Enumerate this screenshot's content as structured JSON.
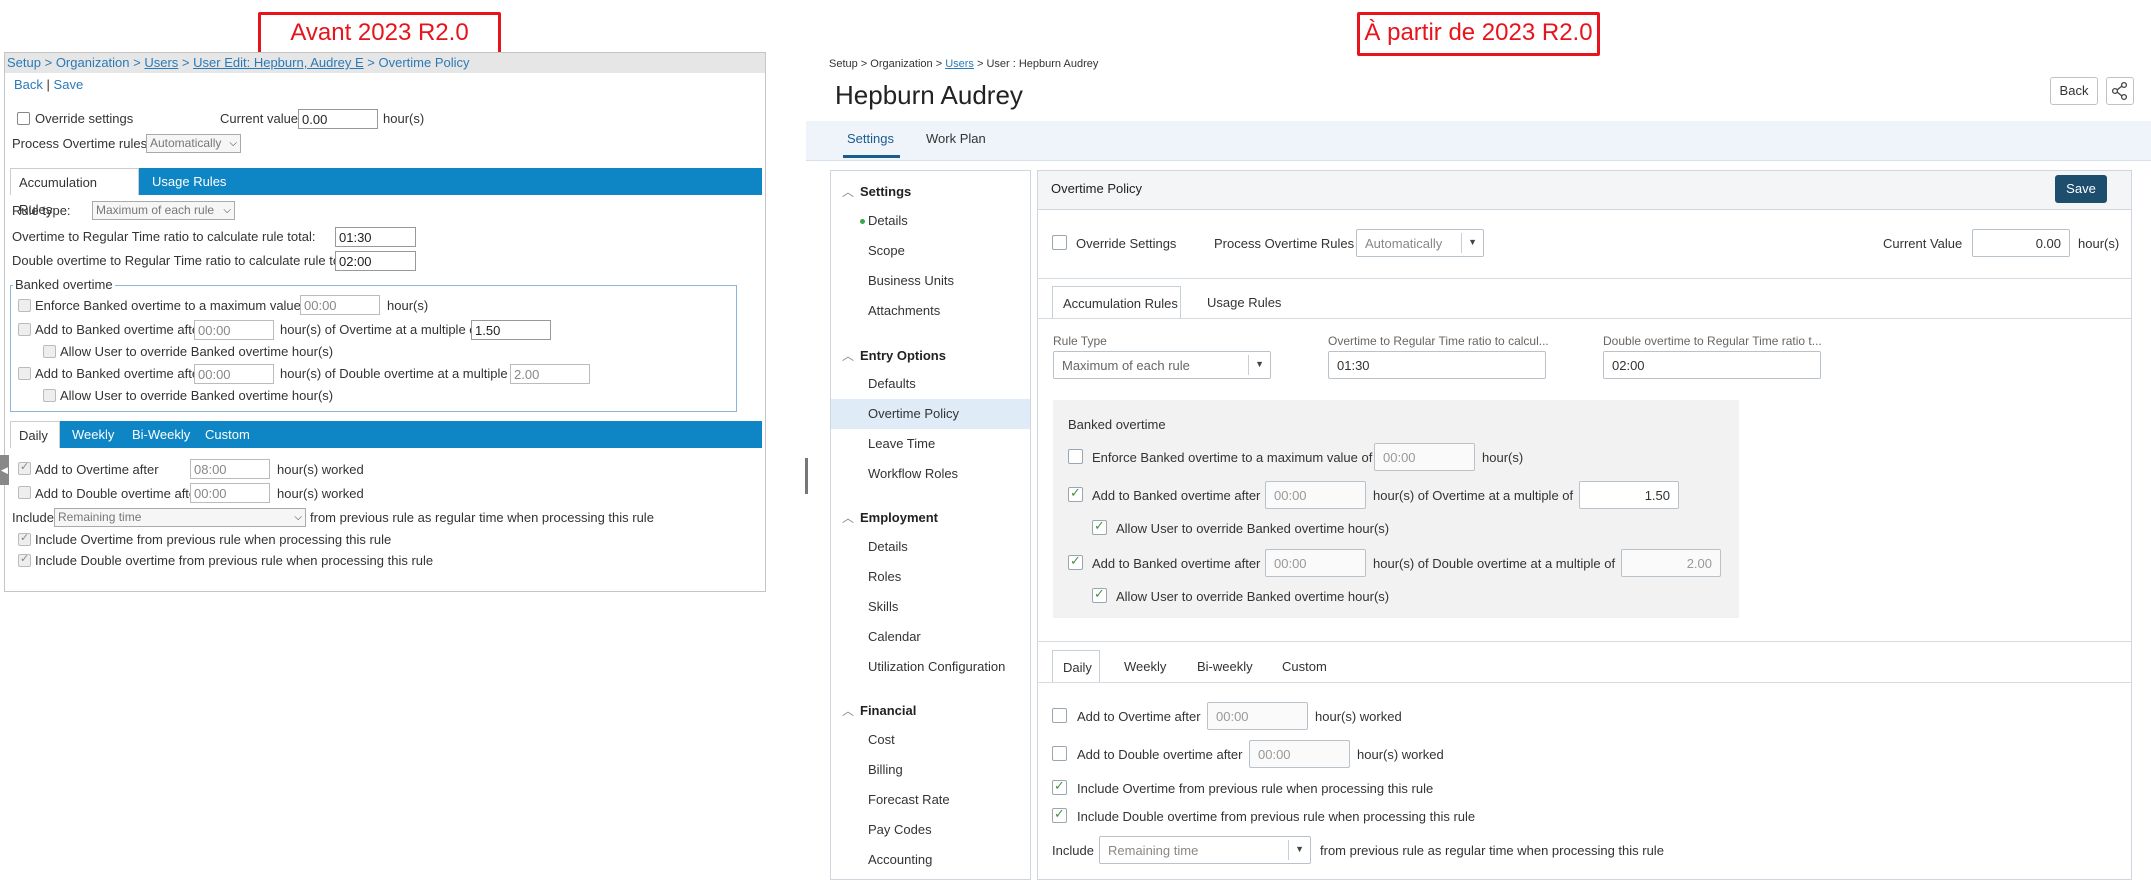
{
  "captions": {
    "left": "Avant 2023 R2.0",
    "right": "À partir de 2023 R2.0"
  },
  "old_ui": {
    "breadcrumb": {
      "setup": "Setup",
      "sep1": " > ",
      "organization": "Organization",
      "sep2": " > ",
      "users": "Users",
      "sep3": " > ",
      "user_edit": "User Edit: Hepburn, Audrey E",
      "sep4": " > ",
      "page": "Overtime Policy"
    },
    "actions": {
      "back": "Back",
      "sep": "|",
      "save": "Save"
    },
    "override_label": "Override settings",
    "current_value_label": "Current value:",
    "current_value": "0.00",
    "hours_unit": "hour(s)",
    "process_label": "Process Overtime rules:",
    "process_value": "Automatically",
    "tabs": [
      "Accumulation Rules",
      "Usage Rules"
    ],
    "rule_type_label": "Rule type:",
    "rule_type_value": "Maximum of each rule",
    "ot_ratio_label": "Overtime to Regular Time ratio to calculate rule total:",
    "ot_ratio_value": "01:30",
    "dot_ratio_label": "Double overtime to Regular Time ratio to calculate rule total:",
    "dot_ratio_value": "02:00",
    "banked_legend": "Banked overtime",
    "enforce_label": "Enforce Banked overtime to a maximum value of",
    "enforce_value": "00:00",
    "add_banked_label": "Add to Banked overtime after",
    "add_banked_value": "00:00",
    "of_overtime_label": "hour(s) of Overtime at a multiple of",
    "ot_multiple": "1.50",
    "allow_override_label": "Allow User to override Banked overtime hour(s)",
    "add_banked2_value": "00:00",
    "of_double_label": "hour(s) of Double overtime at a multiple of",
    "dot_multiple": "2.00",
    "period_tabs": [
      "Daily",
      "Weekly",
      "Bi-Weekly",
      "Custom"
    ],
    "add_ot_label": "Add to Overtime after",
    "add_ot_value": "08:00",
    "worked_label": "hour(s) worked",
    "add_dot_label": "Add to Double overtime after",
    "add_dot_value": "00:00",
    "include_label": "Include",
    "include_value": "Remaining time",
    "include_suffix": "from previous rule as regular time when processing this rule",
    "include_ot_label": "Include Overtime from previous rule when processing this rule",
    "include_dot_label": "Include Double overtime from previous rule when processing this rule"
  },
  "new_ui": {
    "breadcrumb": {
      "pre": "Setup > Organization > ",
      "users": "Users",
      "post": " > User : Hepburn Audrey"
    },
    "title": "Hepburn Audrey",
    "back": "Back",
    "share_icon": "share-icon",
    "main_tabs": [
      "Settings",
      "Work Plan"
    ],
    "sidebar": {
      "settings": {
        "label": "Settings",
        "items": [
          "Details",
          "Scope",
          "Business Units",
          "Attachments"
        ]
      },
      "entry": {
        "label": "Entry Options",
        "items": [
          "Defaults",
          "Overtime Policy",
          "Leave Time",
          "Workflow Roles"
        ]
      },
      "employment": {
        "label": "Employment",
        "items": [
          "Details",
          "Roles",
          "Skills",
          "Calendar",
          "Utilization Configuration"
        ]
      },
      "financial": {
        "label": "Financial",
        "items": [
          "Cost",
          "Billing",
          "Forecast Rate",
          "Pay Codes",
          "Accounting"
        ]
      }
    },
    "panel_title": "Overtime Policy",
    "save": "Save",
    "override_label": "Override Settings",
    "process_label": "Process Overtime Rules",
    "process_value": "Automatically",
    "current_value_label": "Current Value",
    "current_value": "0.00",
    "hours_unit": "hour(s)",
    "tabs": [
      "Accumulation Rules",
      "Usage Rules"
    ],
    "rule_type_label": "Rule Type",
    "rule_type_value": "Maximum of each rule",
    "ot_ratio_label": "Overtime to Regular Time ratio to calcul...",
    "ot_ratio_value": "01:30",
    "dot_ratio_label": "Double overtime to Regular Time ratio t...",
    "dot_ratio_value": "02:00",
    "banked_title": "Banked overtime",
    "enforce_label": "Enforce Banked overtime to a maximum value of",
    "enforce_value": "00:00",
    "add_banked_label": "Add to Banked overtime after",
    "add_banked_value": "00:00",
    "of_overtime_label": "hour(s) of Overtime at a multiple of",
    "ot_multiple": "1.50",
    "allow_override_label": "Allow User  to override Banked overtime hour(s)",
    "add_banked2_value": "00:00",
    "of_double_label": "hour(s) of Double overtime at a multiple of",
    "dot_multiple": "2.00",
    "period_tabs": [
      "Daily",
      "Weekly",
      "Bi-weekly",
      "Custom"
    ],
    "add_ot_label": "Add to Overtime after",
    "add_ot_value": "00:00",
    "worked_label": "hour(s) worked",
    "add_dot_label": "Add to Double overtime after",
    "add_dot_value": "00:00",
    "include_ot_label": "Include Overtime from previous rule when processing this rule",
    "include_dot_label": "Include Double overtime from previous rule when processing this rule",
    "include_label": "Include",
    "include_value": "Remaining time",
    "include_suffix": "from previous rule as regular time when processing this rule"
  },
  "colors": {
    "accent_red": "#e8141b",
    "old_tab_blue": "#0e85c4",
    "save_dark": "#1d4e6e",
    "new_accent": "#1b5c8e"
  }
}
